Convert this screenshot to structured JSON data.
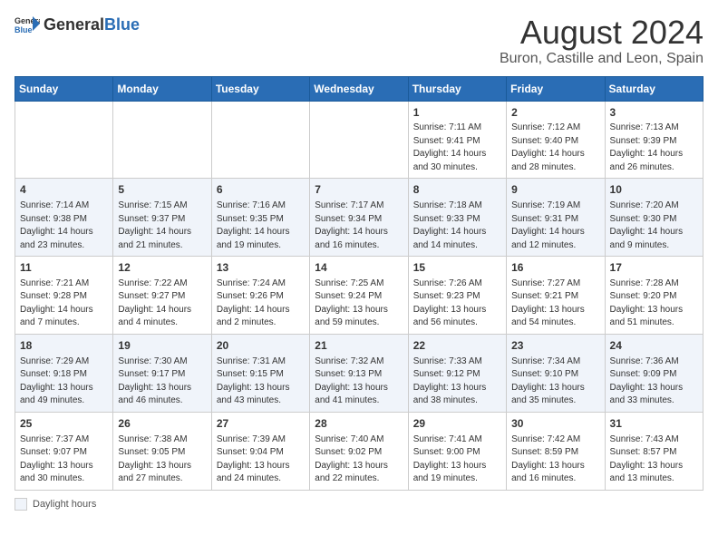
{
  "header": {
    "logo_general": "General",
    "logo_blue": "Blue",
    "title": "August 2024",
    "subtitle": "Buron, Castille and Leon, Spain"
  },
  "days_of_week": [
    "Sunday",
    "Monday",
    "Tuesday",
    "Wednesday",
    "Thursday",
    "Friday",
    "Saturday"
  ],
  "weeks": [
    [
      {
        "day": "",
        "info": ""
      },
      {
        "day": "",
        "info": ""
      },
      {
        "day": "",
        "info": ""
      },
      {
        "day": "",
        "info": ""
      },
      {
        "day": "1",
        "info": "Sunrise: 7:11 AM\nSunset: 9:41 PM\nDaylight: 14 hours and 30 minutes."
      },
      {
        "day": "2",
        "info": "Sunrise: 7:12 AM\nSunset: 9:40 PM\nDaylight: 14 hours and 28 minutes."
      },
      {
        "day": "3",
        "info": "Sunrise: 7:13 AM\nSunset: 9:39 PM\nDaylight: 14 hours and 26 minutes."
      }
    ],
    [
      {
        "day": "4",
        "info": "Sunrise: 7:14 AM\nSunset: 9:38 PM\nDaylight: 14 hours and 23 minutes."
      },
      {
        "day": "5",
        "info": "Sunrise: 7:15 AM\nSunset: 9:37 PM\nDaylight: 14 hours and 21 minutes."
      },
      {
        "day": "6",
        "info": "Sunrise: 7:16 AM\nSunset: 9:35 PM\nDaylight: 14 hours and 19 minutes."
      },
      {
        "day": "7",
        "info": "Sunrise: 7:17 AM\nSunset: 9:34 PM\nDaylight: 14 hours and 16 minutes."
      },
      {
        "day": "8",
        "info": "Sunrise: 7:18 AM\nSunset: 9:33 PM\nDaylight: 14 hours and 14 minutes."
      },
      {
        "day": "9",
        "info": "Sunrise: 7:19 AM\nSunset: 9:31 PM\nDaylight: 14 hours and 12 minutes."
      },
      {
        "day": "10",
        "info": "Sunrise: 7:20 AM\nSunset: 9:30 PM\nDaylight: 14 hours and 9 minutes."
      }
    ],
    [
      {
        "day": "11",
        "info": "Sunrise: 7:21 AM\nSunset: 9:28 PM\nDaylight: 14 hours and 7 minutes."
      },
      {
        "day": "12",
        "info": "Sunrise: 7:22 AM\nSunset: 9:27 PM\nDaylight: 14 hours and 4 minutes."
      },
      {
        "day": "13",
        "info": "Sunrise: 7:24 AM\nSunset: 9:26 PM\nDaylight: 14 hours and 2 minutes."
      },
      {
        "day": "14",
        "info": "Sunrise: 7:25 AM\nSunset: 9:24 PM\nDaylight: 13 hours and 59 minutes."
      },
      {
        "day": "15",
        "info": "Sunrise: 7:26 AM\nSunset: 9:23 PM\nDaylight: 13 hours and 56 minutes."
      },
      {
        "day": "16",
        "info": "Sunrise: 7:27 AM\nSunset: 9:21 PM\nDaylight: 13 hours and 54 minutes."
      },
      {
        "day": "17",
        "info": "Sunrise: 7:28 AM\nSunset: 9:20 PM\nDaylight: 13 hours and 51 minutes."
      }
    ],
    [
      {
        "day": "18",
        "info": "Sunrise: 7:29 AM\nSunset: 9:18 PM\nDaylight: 13 hours and 49 minutes."
      },
      {
        "day": "19",
        "info": "Sunrise: 7:30 AM\nSunset: 9:17 PM\nDaylight: 13 hours and 46 minutes."
      },
      {
        "day": "20",
        "info": "Sunrise: 7:31 AM\nSunset: 9:15 PM\nDaylight: 13 hours and 43 minutes."
      },
      {
        "day": "21",
        "info": "Sunrise: 7:32 AM\nSunset: 9:13 PM\nDaylight: 13 hours and 41 minutes."
      },
      {
        "day": "22",
        "info": "Sunrise: 7:33 AM\nSunset: 9:12 PM\nDaylight: 13 hours and 38 minutes."
      },
      {
        "day": "23",
        "info": "Sunrise: 7:34 AM\nSunset: 9:10 PM\nDaylight: 13 hours and 35 minutes."
      },
      {
        "day": "24",
        "info": "Sunrise: 7:36 AM\nSunset: 9:09 PM\nDaylight: 13 hours and 33 minutes."
      }
    ],
    [
      {
        "day": "25",
        "info": "Sunrise: 7:37 AM\nSunset: 9:07 PM\nDaylight: 13 hours and 30 minutes."
      },
      {
        "day": "26",
        "info": "Sunrise: 7:38 AM\nSunset: 9:05 PM\nDaylight: 13 hours and 27 minutes."
      },
      {
        "day": "27",
        "info": "Sunrise: 7:39 AM\nSunset: 9:04 PM\nDaylight: 13 hours and 24 minutes."
      },
      {
        "day": "28",
        "info": "Sunrise: 7:40 AM\nSunset: 9:02 PM\nDaylight: 13 hours and 22 minutes."
      },
      {
        "day": "29",
        "info": "Sunrise: 7:41 AM\nSunset: 9:00 PM\nDaylight: 13 hours and 19 minutes."
      },
      {
        "day": "30",
        "info": "Sunrise: 7:42 AM\nSunset: 8:59 PM\nDaylight: 13 hours and 16 minutes."
      },
      {
        "day": "31",
        "info": "Sunrise: 7:43 AM\nSunset: 8:57 PM\nDaylight: 13 hours and 13 minutes."
      }
    ]
  ],
  "footer": {
    "daylight_label": "Daylight hours"
  }
}
